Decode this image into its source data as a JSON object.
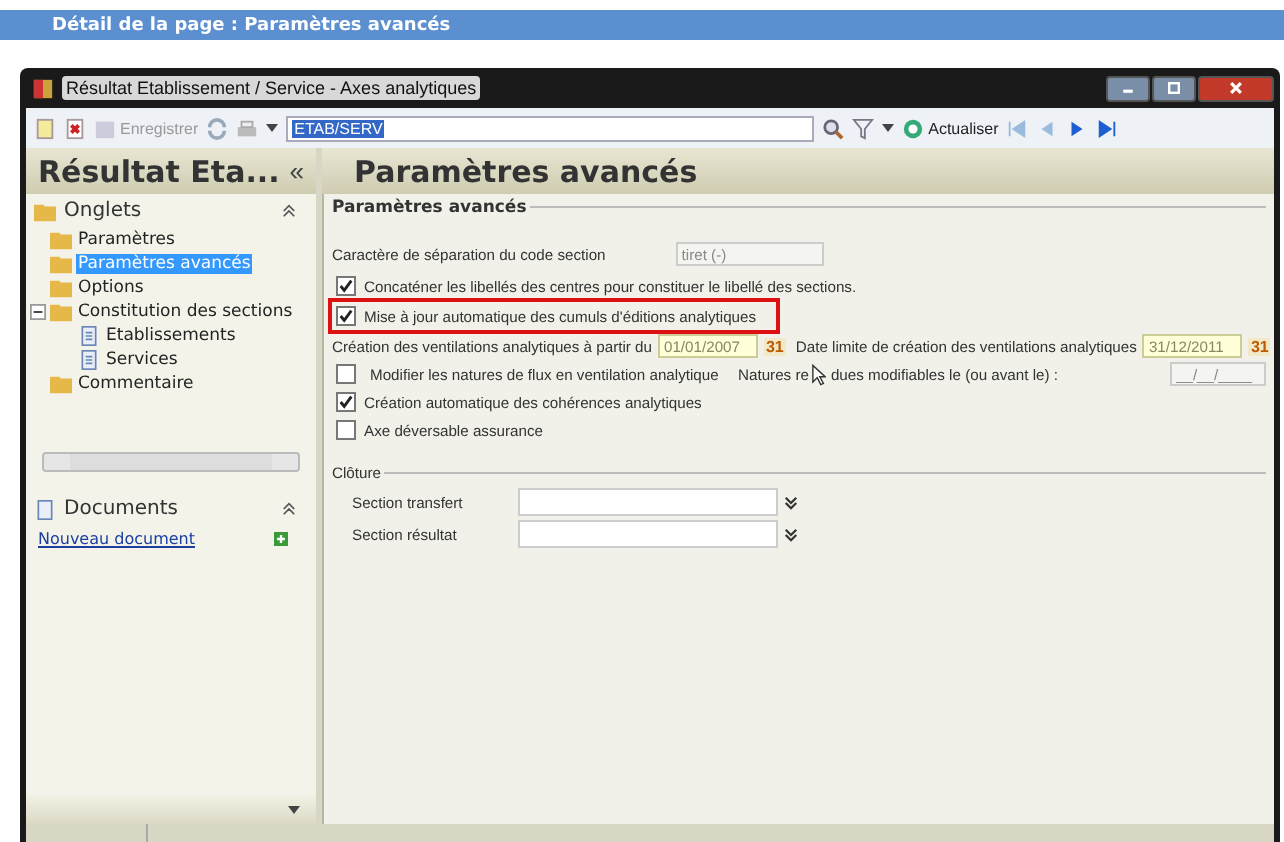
{
  "page_bar": {
    "title": "Détail de la page : Paramètres avancés"
  },
  "window": {
    "title": "Résultat Etablissement / Service -  Axes analytiques"
  },
  "toolbar": {
    "save_label": "Enregistrer",
    "code_value": "ETAB/SERV",
    "refresh_label": "Actualiser"
  },
  "left_header": {
    "title": "Résultat Eta...",
    "collapse": "«"
  },
  "page_header": {
    "title": "Paramètres avancés"
  },
  "onglets": {
    "title": "Onglets",
    "items": [
      {
        "label": "Paramètres",
        "selected": false
      },
      {
        "label": "Paramètres avancés",
        "selected": true
      },
      {
        "label": "Options",
        "selected": false
      },
      {
        "label": "Constitution des sections",
        "selected": false,
        "expanded": true,
        "children": [
          {
            "label": "Etablissements",
            "selected": false
          },
          {
            "label": "Services",
            "selected": false
          }
        ]
      },
      {
        "label": "Commentaire",
        "selected": false
      }
    ]
  },
  "documents": {
    "title": "Documents",
    "link": "Nouveau document"
  },
  "group": {
    "title": "Paramètres avancés",
    "separator_label": "Caractère de séparation du code section",
    "separator_value": "tiret (-)",
    "checks_top": [
      {
        "label": "Concaténer les libellés des centres pour constituer le libellé des sections.",
        "checked": true,
        "highlighted": false
      },
      {
        "label": "Mise à jour automatique des cumuls d'éditions analytiques",
        "checked": true,
        "highlighted": true
      }
    ],
    "creation_label": "Création des ventilations analytiques à partir du",
    "creation_date": "01/01/2007",
    "limit_label": "Date limite de création des ventilations analytiques",
    "limit_date": "31/12/2011",
    "creation_calendar": "31",
    "limit_calendar": "31",
    "flux": {
      "label": "Modifier les natures de flux en ventilation analytique",
      "checked": false
    },
    "natures_label_start": "Natures re",
    "natures_label_end": "dues modifiables le (ou avant le) :",
    "natures_value": "__/__/____",
    "checks_bottom": [
      {
        "label": "Création automatique des cohérences analytiques",
        "checked": true
      },
      {
        "label": "Axe déversable assurance",
        "checked": false
      }
    ]
  },
  "cloture": {
    "title": "Clôture",
    "fields": [
      {
        "label": "Section transfert"
      },
      {
        "label": "Section résultat"
      }
    ]
  }
}
